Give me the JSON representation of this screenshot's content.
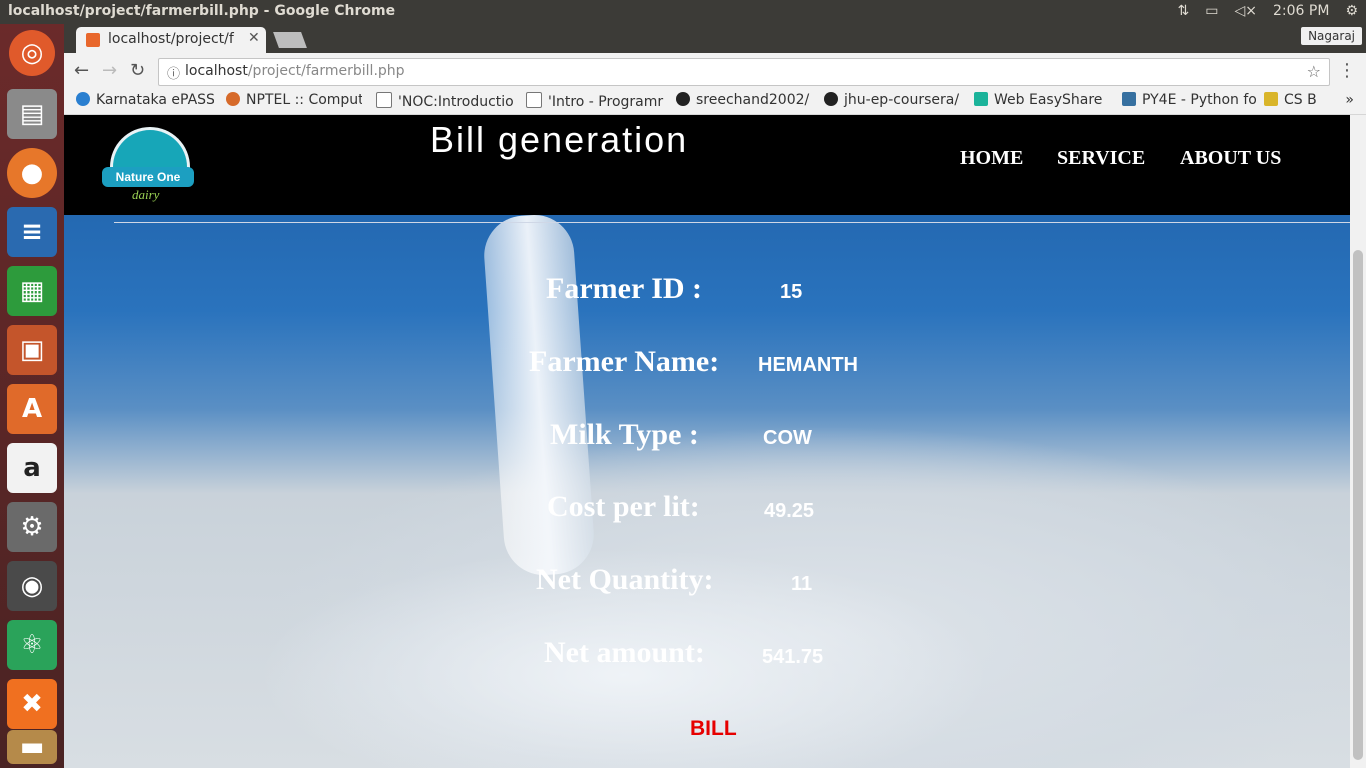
{
  "os": {
    "window_title": "localhost/project/farmerbill.php - Google Chrome",
    "clock": "2:06 PM",
    "tray_icons": [
      "arrows-updown-icon",
      "battery-icon",
      "volume-muted-icon",
      "gear-icon"
    ],
    "launcher": [
      "ubuntu-dash-icon",
      "files-icon",
      "firefox-icon",
      "writer-icon",
      "calc-icon",
      "impress-icon",
      "software-center-icon",
      "amazon-icon",
      "system-settings-icon",
      "chrome-icon",
      "atom-icon",
      "xampp-icon",
      "trash-icon"
    ]
  },
  "browser": {
    "tab_title": "localhost/project/f",
    "user": "Nagaraj",
    "url_host": "localhost",
    "url_path": "/project/farmerbill.php",
    "bookmarks": [
      "Karnataka ePASS",
      "NPTEL :: Comput",
      "'NOC:Introductio",
      "'Intro - Programr",
      "sreechand2002/",
      "jhu-ep-coursera/",
      "Web EasyShare",
      "PY4E - Python fo",
      "CS B"
    ]
  },
  "page": {
    "logo": {
      "name": "Nature One",
      "tagline": "dairy"
    },
    "title": "Bill generation",
    "nav": [
      "HOME",
      "SERVICE",
      "ABOUT US"
    ],
    "fields": [
      {
        "label": "Farmer ID :",
        "value": "15"
      },
      {
        "label": "Farmer Name:",
        "value": "HEMANTH"
      },
      {
        "label": "Milk Type :",
        "value": "COW"
      },
      {
        "label": "Cost per lit:",
        "value": "49.25"
      },
      {
        "label": "Net Quantity:",
        "value": "11"
      },
      {
        "label": "Net amount:",
        "value": "541.75"
      }
    ],
    "bill_button": "BILL",
    "bill_color": "#e60000"
  }
}
